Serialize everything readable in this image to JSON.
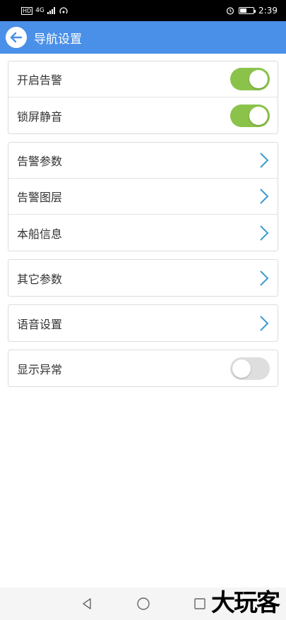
{
  "status_bar": {
    "left_badge": "HD",
    "network": "4G",
    "time": "2:39"
  },
  "app_bar": {
    "title": "导航设置"
  },
  "groups": [
    {
      "rows": [
        {
          "label": "开启告警",
          "control": "toggle",
          "on": true
        },
        {
          "label": "锁屏静音",
          "control": "toggle",
          "on": true
        }
      ]
    },
    {
      "rows": [
        {
          "label": "告警参数",
          "control": "chevron"
        },
        {
          "label": "告警图层",
          "control": "chevron"
        },
        {
          "label": "本船信息",
          "control": "chevron"
        }
      ]
    },
    {
      "rows": [
        {
          "label": "其它参数",
          "control": "chevron"
        }
      ]
    },
    {
      "rows": [
        {
          "label": "语音设置",
          "control": "chevron"
        }
      ]
    },
    {
      "rows": [
        {
          "label": "显示异常",
          "control": "toggle",
          "on": false
        }
      ]
    }
  ],
  "watermark": "大玩客",
  "colors": {
    "app_bar": "#4a90e8",
    "toggle_on": "#8bc34a",
    "toggle_off": "#dedede",
    "chevron": "#3b9bd0"
  }
}
